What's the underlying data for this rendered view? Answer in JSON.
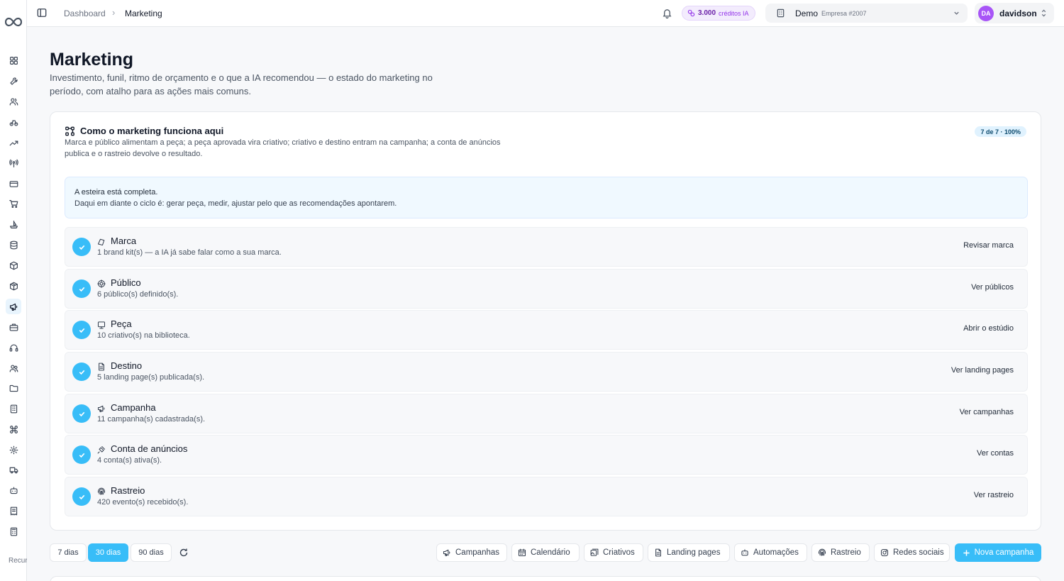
{
  "breadcrumb": {
    "parent": "Dashboard",
    "separator": "›",
    "current": "Marketing"
  },
  "credits": {
    "amount": "3.000",
    "label": "créditos IA"
  },
  "company": {
    "name": "Demo",
    "subtitle": "Empresa #2007"
  },
  "user": {
    "initials": "DA",
    "name": "davidson"
  },
  "sidebar": {
    "items": [
      "dashboard-icon",
      "tools-icon",
      "users-icon",
      "bike-icon",
      "trend-icon",
      "antenna-icon",
      "card-icon",
      "cart-icon",
      "ship-icon",
      "database-icon",
      "box-icon",
      "package-icon",
      "megaphone-icon",
      "briefcase-icon",
      "headset-icon",
      "team-icon",
      "folder-icon",
      "building-icon",
      "command-icon",
      "gear-icon",
      "truck-icon",
      "robot-icon",
      "receipt-icon",
      "calculator-icon"
    ],
    "active": "megaphone-icon",
    "footer": "Recursos avançados"
  },
  "page": {
    "title": "Marketing",
    "subtitle": "Investimento, funil, ritmo de orçamento e o que a IA recomendou — o estado do marketing no período, com atalho para as ações mais comuns."
  },
  "flow": {
    "title": "Como o marketing funciona aqui",
    "description": "Marca e público alimentam a peça; a peça aprovada vira criativo; criativo e destino entram na campanha; a conta de anúncios publica e o rastreio devolve o resultado.",
    "progress": "7 de 7 · 100%",
    "banner_title": "A esteira está completa.",
    "banner_text": "Daqui em diante o ciclo é: gerar peça, medir, ajustar pelo que as recomendações apontarem.",
    "steps": [
      {
        "name": "Marca",
        "desc": "1 brand kit(s) — a IA já sabe falar como a sua marca.",
        "action": "Revisar marca",
        "icon": "palette-icon"
      },
      {
        "name": "Público",
        "desc": "6 público(s) definido(s).",
        "action": "Ver públicos",
        "icon": "target-icon"
      },
      {
        "name": "Peça",
        "desc": "10 criativo(s) na biblioteca.",
        "action": "Abrir o estúdio",
        "icon": "image-icon"
      },
      {
        "name": "Destino",
        "desc": "5 landing page(s) publicada(s).",
        "action": "Ver landing pages",
        "icon": "page-icon"
      },
      {
        "name": "Campanha",
        "desc": "11 campanha(s) cadastrada(s).",
        "action": "Ver campanhas",
        "icon": "megaphone-icon"
      },
      {
        "name": "Conta de anúncios",
        "desc": "4 conta(s) ativa(s).",
        "action": "Ver contas",
        "icon": "plug-icon"
      },
      {
        "name": "Rastreio",
        "desc": "420 evento(s) recebido(s).",
        "action": "Ver rastreio",
        "icon": "fingerprint-icon"
      }
    ]
  },
  "ranges": [
    {
      "label": "7 dias",
      "active": false
    },
    {
      "label": "30 dias",
      "active": true
    },
    {
      "label": "90 dias",
      "active": false
    }
  ],
  "toolbar": {
    "buttons": [
      {
        "label": "Campanhas",
        "icon": "megaphone-icon"
      },
      {
        "label": "Calendário",
        "icon": "calendar-icon"
      },
      {
        "label": "Criativos",
        "icon": "images-icon"
      },
      {
        "label": "Landing pages",
        "icon": "page-icon"
      },
      {
        "label": "Automações",
        "icon": "robot-icon"
      },
      {
        "label": "Rastreio",
        "icon": "fingerprint-icon"
      },
      {
        "label": "Redes sociais",
        "icon": "instagram-icon"
      }
    ],
    "primary": "Nova campanha"
  },
  "colors": {
    "accent": "#38bdf8",
    "credits": "#9333ea",
    "avatar": "#a855f7"
  }
}
